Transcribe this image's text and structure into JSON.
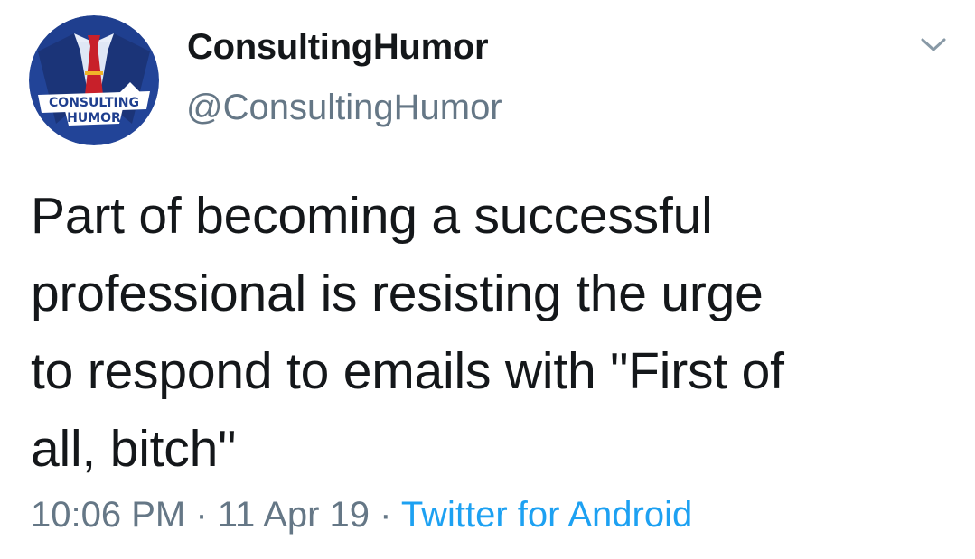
{
  "user": {
    "display_name": "ConsultingHumor",
    "handle": "@ConsultingHumor",
    "avatar_icon": "consulting-humor-logo-icon",
    "avatar_logo_text": [
      "CONSULTING",
      "HUMOR"
    ]
  },
  "menu": {
    "icon": "chevron-down-icon"
  },
  "tweet": {
    "text": "Part of becoming a successful\nprofessional is resisting the urge\nto respond to emails with \"First of\nall, bitch\""
  },
  "meta": {
    "time": "10:06 PM",
    "separator_1": " · ",
    "date": "11 Apr 19",
    "separator_2": " · ",
    "source": "Twitter for Android"
  },
  "colors": {
    "text": "#14171a",
    "secondary": "#657786",
    "link": "#1da1f2",
    "avatar_bg": "#1f3f8f",
    "tie": "#c8202a"
  }
}
